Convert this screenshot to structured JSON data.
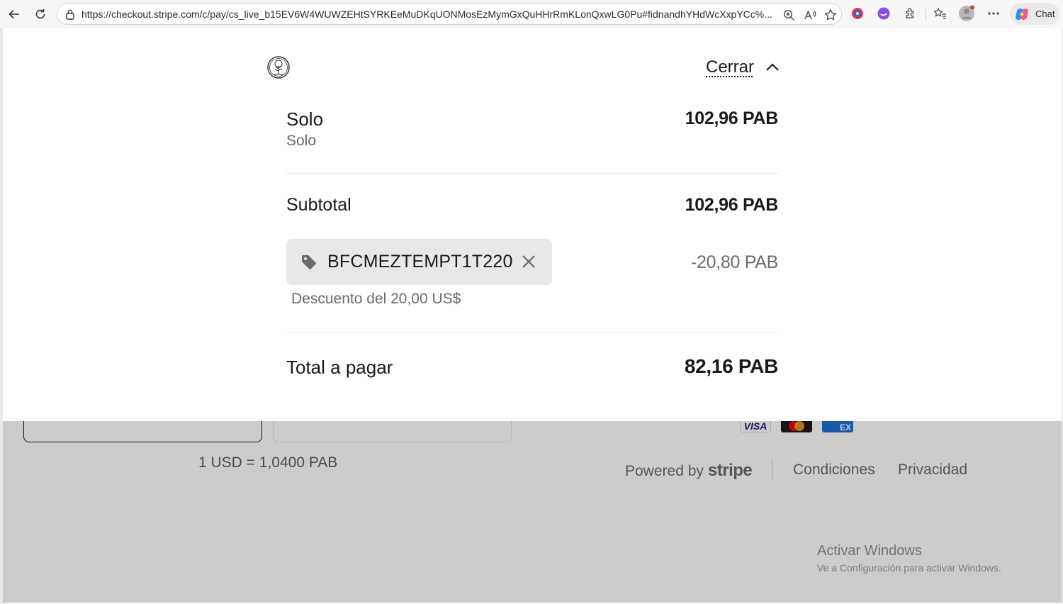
{
  "browser": {
    "url": "https://checkout.stripe.com/c/pay/cs_live_b15EV6W4WUWZEHtSYRKEeMuDKqUONMosEzMymGxQuHHrRmKLonQxwLG0Pu#fidnandhYHdWcXxpYCc%...",
    "chat_label": "Chat"
  },
  "summary": {
    "close_label": "Cerrar",
    "item": {
      "name": "Solo",
      "description": "Solo",
      "price": "102,96 PAB"
    },
    "subtotal": {
      "label": "Subtotal",
      "value": "102,96 PAB"
    },
    "promo": {
      "code": "BFCMEZTEMPT1T220",
      "discount_value": "-20,80 PAB",
      "description": "Descuento del 20,00 US$"
    },
    "total": {
      "label": "Total a pagar",
      "value": "82,16 PAB"
    }
  },
  "background": {
    "exchange_rate": "1 USD = 1,0400 PAB",
    "visa_label": "VISA",
    "amex_label": "EX",
    "powered_by": "Powered by",
    "stripe_word": "stripe",
    "terms_link": "Condiciones",
    "privacy_link": "Privacidad"
  },
  "windows_watermark": {
    "title": "Activar Windows",
    "subtitle": "Ve a Configuración para activar Windows."
  },
  "colors": {
    "text_primary": "#1a1a1a",
    "text_secondary": "#6b6b6b",
    "chip_bg": "#e8e8e8",
    "overlay": "rgba(0,0,0,0.2)"
  }
}
